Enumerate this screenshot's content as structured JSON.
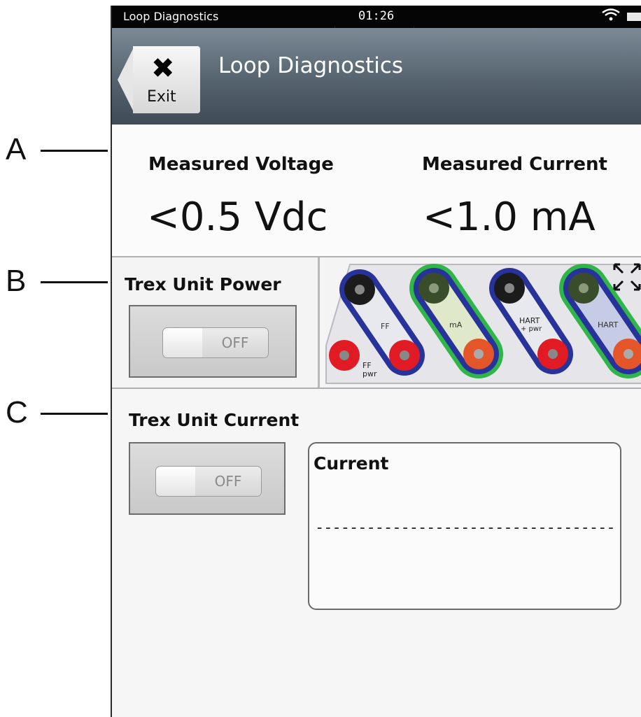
{
  "callouts": [
    "A",
    "B",
    "C"
  ],
  "status_bar": {
    "app_name": "Loop Diagnostics",
    "time": "01:26",
    "wifi_icon": "wifi-icon",
    "battery_icon": "battery-icon"
  },
  "header": {
    "exit_label": "Exit",
    "exit_icon": "close-icon",
    "title": "Loop Diagnostics"
  },
  "measurements": {
    "voltage_label": "Measured Voltage",
    "voltage_value": "<0.5 Vdc",
    "current_label": "Measured Current",
    "current_value": "<1.0 mA"
  },
  "power": {
    "label": "Trex Unit Power",
    "toggle_state": "OFF",
    "expand_icon": "expand-icon",
    "terminals": {
      "labels": [
        "FF",
        "FF pwr",
        "mA",
        "HART + pwr",
        "HART"
      ],
      "colors": {
        "black": "#1b1b1b",
        "red": "#e01b24",
        "blue_loop": "#27339a",
        "green_highlight": "#2fb548",
        "dark_green": "#3a4d2a",
        "orange": "#e5552a"
      }
    }
  },
  "current": {
    "label": "Trex Unit Current",
    "toggle_state": "OFF",
    "box_label": "Current",
    "box_value": "--------------------------------------"
  }
}
